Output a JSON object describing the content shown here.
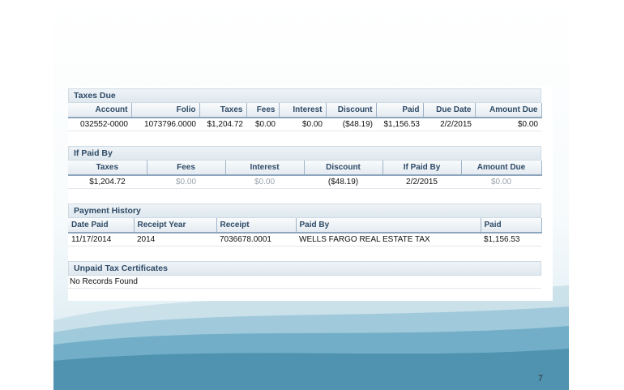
{
  "page_number": "7",
  "taxes_due": {
    "title": "Taxes Due",
    "headers": [
      "Account",
      "Folio",
      "Taxes",
      "Fees",
      "Interest",
      "Discount",
      "Paid",
      "Due Date",
      "Amount Due"
    ],
    "row": [
      "032552-0000",
      "1073796.0000",
      "$1,204.72",
      "$0.00",
      "$0.00",
      "($48.19)",
      "$1,156.53",
      "2/2/2015",
      "$0.00"
    ]
  },
  "if_paid_by": {
    "title": "If Paid By",
    "headers": [
      "Taxes",
      "Fees",
      "Interest",
      "Discount",
      "If Paid By",
      "Amount Due"
    ],
    "row": [
      "$1,204.72",
      "$0.00",
      "$0.00",
      "($48.19)",
      "2/2/2015",
      "$0.00"
    ]
  },
  "payment_history": {
    "title": "Payment History",
    "headers": [
      "Date Paid",
      "Receipt Year",
      "Receipt",
      "Paid By",
      "Paid"
    ],
    "row": [
      "11/17/2014",
      "2014",
      "7036678.0001",
      "WELLS FARGO REAL ESTATE TAX",
      "$1,156.53"
    ]
  },
  "unpaid_certificates": {
    "title": "Unpaid Tax Certificates",
    "message": "No Records Found"
  },
  "colors": {
    "section_header_text": "#2e4a66",
    "muted_value": "#9aa4ad",
    "wave_blue": "#5b9fb8"
  }
}
